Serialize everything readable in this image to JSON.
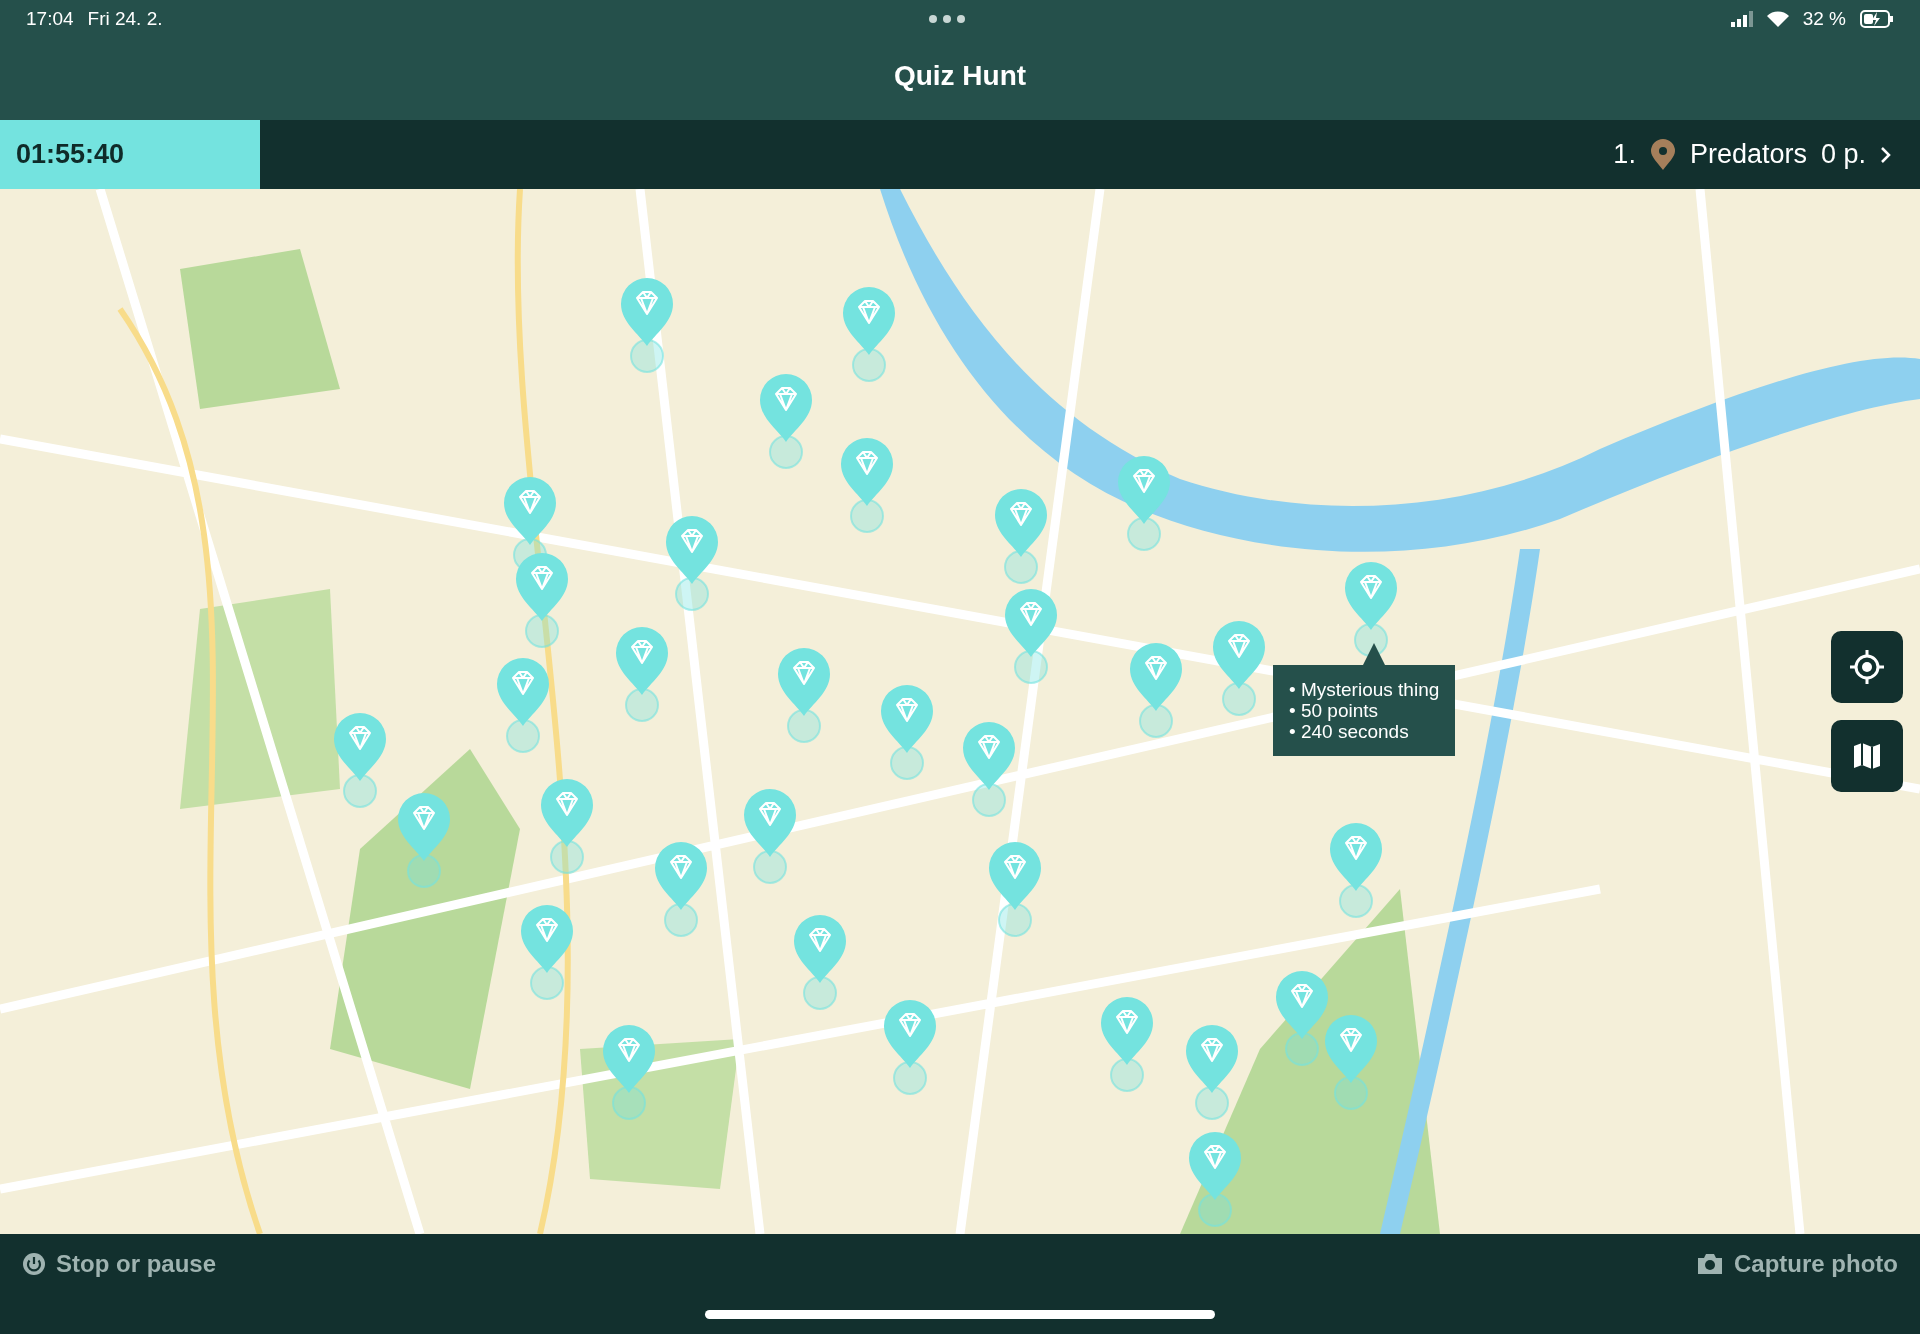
{
  "status_bar": {
    "time": "17:04",
    "date": "Fri 24. 2.",
    "battery": "32 %"
  },
  "header": {
    "title": "Quiz Hunt"
  },
  "game_bar": {
    "timer": "01:55:40",
    "rank": "1.",
    "team": "Predators",
    "points": "0 p."
  },
  "map": {
    "kind": "picture",
    "tooltip": [
      "• Mysterious thing",
      "• 50 points",
      "• 240 seconds"
    ]
  },
  "bottom_bar": {
    "stop": "Stop or pause",
    "capture": "Capture photo"
  }
}
